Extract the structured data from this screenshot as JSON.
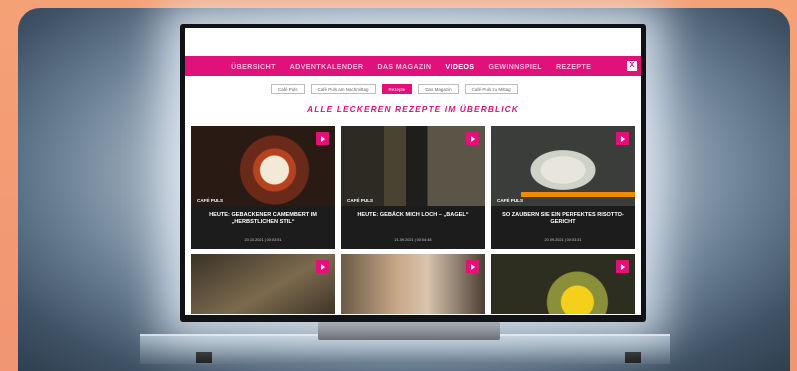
{
  "nav": {
    "items": [
      "ÜBERSICHT",
      "ADVENTKALENDER",
      "DAS MAGAZIN",
      "VIDEOS",
      "GEWINNSPIEL",
      "REZEPTE"
    ],
    "active": "VIDEOS",
    "close_label": "X"
  },
  "subnav": {
    "items": [
      "Café Puls",
      "Café Puls am Nachmittag",
      "Rezepte",
      "Das Magazin",
      "Café Puls zu Mittag"
    ],
    "active": "Rezepte"
  },
  "heading": "ALLE LECKEREN REZEPTE IM ÜBERBLICK",
  "cards": [
    {
      "tag": "CAFÉ PULS",
      "title": "HEUTE: GEBACKENER CAMEMBERT IM „HERBSTLICHEN STIL“",
      "meta": "20.10.2021 | 00:03:51"
    },
    {
      "tag": "CAFÉ PULS",
      "title": "HEUTE: GEBÄCK MICH LOCH – „BAGEL“",
      "meta": "21.09.2021 | 00:04:48"
    },
    {
      "tag": "CAFÉ PULS",
      "title": "SO ZAUBERN SIE EIN PERFEKTES RISOTTO-GERICHT",
      "meta": "20.09.2021 | 00:03:31"
    }
  ],
  "colors": {
    "brand": "#e0117b",
    "card_bg": "#1c1c1c",
    "orange_banner": "#f08a00"
  }
}
